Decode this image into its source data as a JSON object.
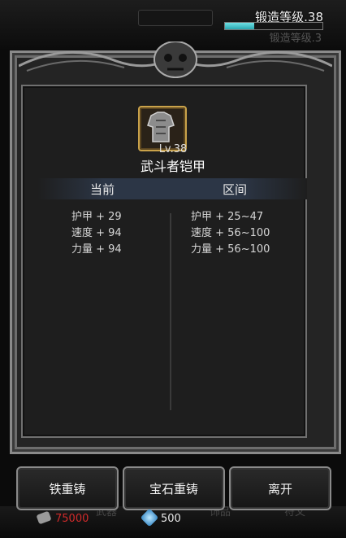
{
  "forge": {
    "level_label": "锻造等级.38",
    "progress": 0.3,
    "ghost_text": "锻造等级.3"
  },
  "item": {
    "level": "Lv.38",
    "name": "武斗者铠甲",
    "icon": "armor-icon"
  },
  "columns": {
    "current": "当前",
    "range": "区间"
  },
  "current_stats": [
    "护甲 + 29",
    "速度 + 94",
    "力量 + 94"
  ],
  "range_stats": [
    "护甲 + 25~47",
    "速度 + 56~100",
    "力量 + 56~100"
  ],
  "buttons": {
    "iron_recast": "铁重铸",
    "gem_recast": "宝石重铸",
    "leave": "离开"
  },
  "bottom": {
    "gold": "75000",
    "gems": "500",
    "ghost_tabs": [
      "武器",
      "饰品",
      "符文"
    ]
  },
  "colors": {
    "progress": "#3bbfc8",
    "gold_text": "#d02a2a",
    "frame": "#8a8a8a"
  }
}
